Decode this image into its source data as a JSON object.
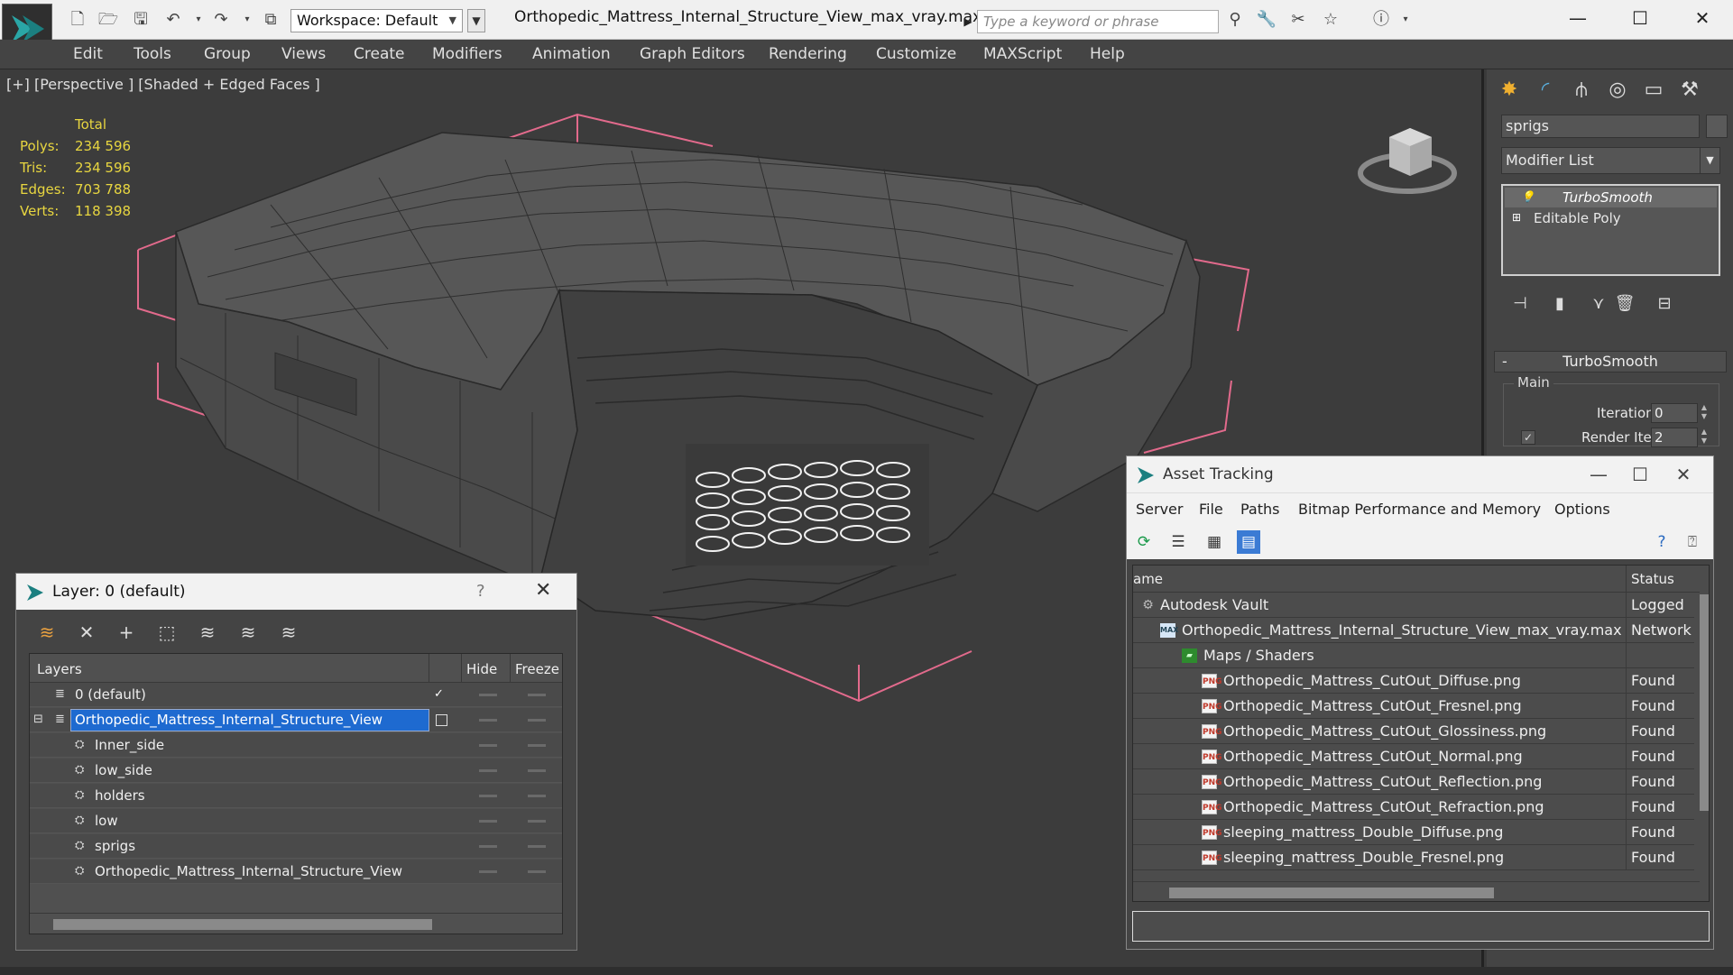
{
  "window": {
    "title": "Orthopedic_Mattress_Internal_Structure_View_max_vray.max",
    "workspace": "Workspace: Default",
    "search_placeholder": "Type a keyword or phrase",
    "minimize": "—",
    "maximize": "☐",
    "close": "✕"
  },
  "menu": [
    "Edit",
    "Tools",
    "Group",
    "Views",
    "Create",
    "Modifiers",
    "Animation",
    "Graph Editors",
    "Rendering",
    "Customize",
    "MAXScript",
    "Help"
  ],
  "viewport": {
    "label": "[+] [Perspective ] [Shaded + Edged Faces ]",
    "stats_header": "Total",
    "stats": [
      {
        "label": "Polys:",
        "value": "234 596"
      },
      {
        "label": "Tris:",
        "value": "234 596"
      },
      {
        "label": "Edges:",
        "value": "703 788"
      },
      {
        "label": "Verts:",
        "value": "118 398"
      }
    ]
  },
  "command_panel": {
    "object_name": "sprigs",
    "modifier_list": "Modifier List",
    "stack": [
      "TurboSmooth",
      "Editable Poly"
    ],
    "rollout_title": "TurboSmooth",
    "rollout_minus": "-",
    "group_main": "Main",
    "iterations_label": "Iterations:",
    "iterations_value": "0",
    "render_iters_label": "Render Iters:",
    "render_iters_value": "2",
    "render_iters_checked": "✓"
  },
  "layer_dialog": {
    "title": "Layer: 0 (default)",
    "help": "?",
    "close": "✕",
    "col_layers": "Layers",
    "col_hide": "Hide",
    "col_freeze": "Freeze",
    "rows": [
      {
        "name": "0 (default)",
        "level": 0,
        "active": "✓"
      },
      {
        "name": "Orthopedic_Mattress_Internal_Structure_View",
        "level": 0,
        "expand": "⊟"
      },
      {
        "name": "Inner_side",
        "level": 1
      },
      {
        "name": "low_side",
        "level": 1
      },
      {
        "name": "holders",
        "level": 1
      },
      {
        "name": "low",
        "level": 1
      },
      {
        "name": "sprigs",
        "level": 1
      },
      {
        "name": "Orthopedic_Mattress_Internal_Structure_View",
        "level": 1
      }
    ]
  },
  "asset_dialog": {
    "title": "Asset Tracking",
    "menu": [
      "Server",
      "File",
      "Paths",
      "Bitmap Performance and Memory",
      "Options"
    ],
    "col_name": "ame",
    "col_status": "Status",
    "png_badge": "PNG",
    "rows": [
      {
        "name": "Autodesk Vault",
        "status": "Logged",
        "level": 0,
        "icon": "vault"
      },
      {
        "name": "Orthopedic_Mattress_Internal_Structure_View_max_vray.max",
        "status": "Network",
        "level": 1,
        "icon": "max"
      },
      {
        "name": "Maps / Shaders",
        "status": "",
        "level": 2,
        "icon": "folder"
      },
      {
        "name": "Orthopedic_Mattress_CutOut_Diffuse.png",
        "status": "Found",
        "level": 3,
        "icon": "png"
      },
      {
        "name": "Orthopedic_Mattress_CutOut_Fresnel.png",
        "status": "Found",
        "level": 3,
        "icon": "png"
      },
      {
        "name": "Orthopedic_Mattress_CutOut_Glossiness.png",
        "status": "Found",
        "level": 3,
        "icon": "png"
      },
      {
        "name": "Orthopedic_Mattress_CutOut_Normal.png",
        "status": "Found",
        "level": 3,
        "icon": "png"
      },
      {
        "name": "Orthopedic_Mattress_CutOut_Reflection.png",
        "status": "Found",
        "level": 3,
        "icon": "png"
      },
      {
        "name": "Orthopedic_Mattress_CutOut_Refraction.png",
        "status": "Found",
        "level": 3,
        "icon": "png"
      },
      {
        "name": "sleeping_mattress_Double_Diffuse.png",
        "status": "Found",
        "level": 3,
        "icon": "png"
      },
      {
        "name": "sleeping_mattress_Double_Fresnel.png",
        "status": "Found",
        "level": 3,
        "icon": "png"
      }
    ]
  },
  "colors": {
    "stats": "#e8d640",
    "selection": "#1e6ad0",
    "bbox": "#e26a8c"
  }
}
